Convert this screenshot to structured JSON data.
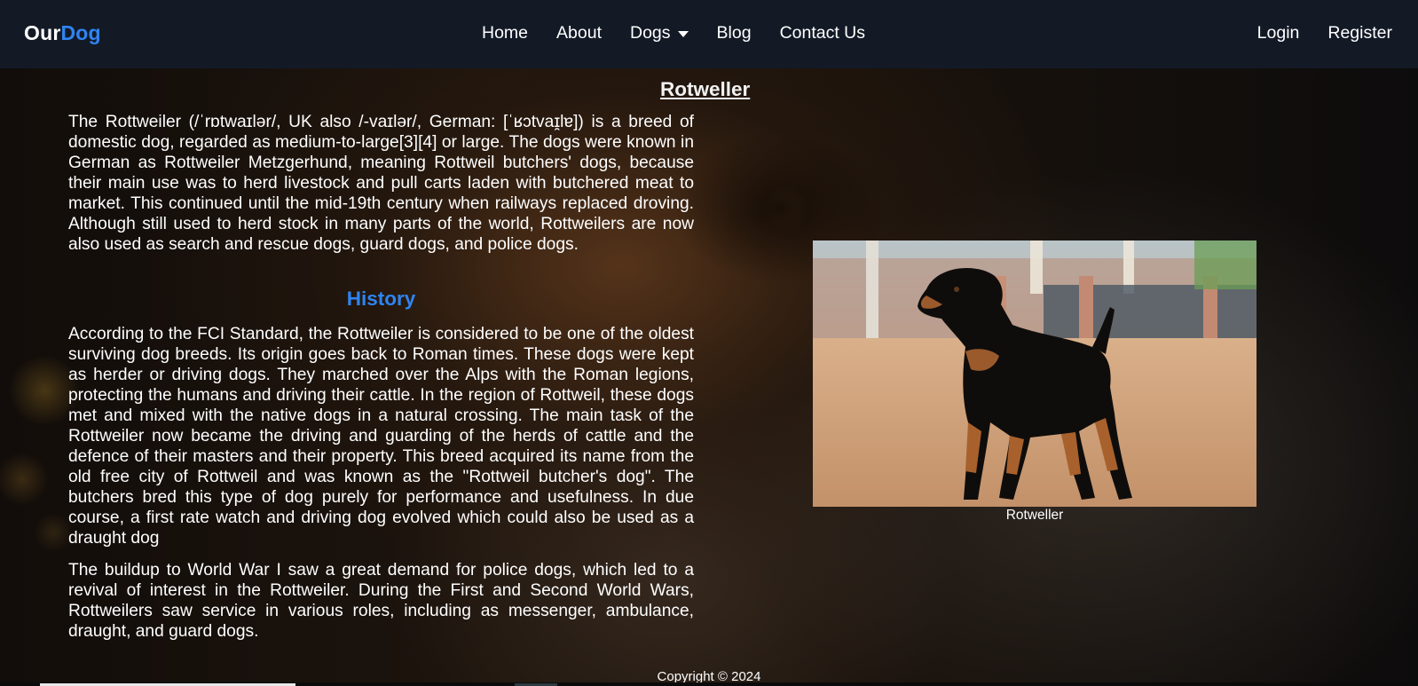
{
  "brand": {
    "part1": "Our",
    "part2": "Dog"
  },
  "nav": {
    "home": "Home",
    "about": "About",
    "dogs": "Dogs",
    "blog": "Blog",
    "contact": "Contact Us",
    "login": "Login",
    "register": "Register"
  },
  "icons": {
    "dogs_menu": "caret-down-icon"
  },
  "article": {
    "title": "Rotweller",
    "intro": "The Rottweiler (/ˈrɒtwaɪlər/, UK also /-vaɪlər/, German: [ˈʁɔtvaɪ̯lɐ]) is a breed of domestic dog, regarded as medium-to-large[3][4] or large. The dogs were known in German as Rottweiler Metzgerhund, meaning Rottweil butchers' dogs, because their main use was to herd livestock and pull carts laden with butchered meat to market. This continued until the mid-19th century when railways replaced droving. Although still used to herd stock in many parts of the world, Rottweilers are now also used as search and rescue dogs, guard dogs, and police dogs.",
    "history_heading": "History",
    "history_p1": "According to the FCI Standard, the Rottweiler is considered to be one of the oldest surviving dog breeds. Its origin goes back to Roman times. These dogs were kept as herder or driving dogs. They marched over the Alps with the Roman legions, protecting the humans and driving their cattle. In the region of Rottweil, these dogs met and mixed with the native dogs in a natural crossing. The main task of the Rottweiler now became the driving and guarding of the herds of cattle and the defence of their masters and their property. This breed acquired its name from the old free city of Rottweil and was known as the \"Rottweil butcher's dog\". The butchers bred this type of dog purely for performance and usefulness. In due course, a first rate watch and driving dog evolved which could also be used as a draught dog",
    "history_p2": "The buildup to World War I saw a great demand for police dogs, which led to a revival of interest in the Rottweiler. During the First and Second World Wars, Rottweilers saw service in various roles, including as messenger, ambulance, draught, and guard dogs."
  },
  "figure": {
    "caption": "Rotweller"
  },
  "footer": {
    "copyright": "Copyright © 2024"
  },
  "colors": {
    "navbar": "#131a26",
    "accent": "#2f84f2"
  }
}
